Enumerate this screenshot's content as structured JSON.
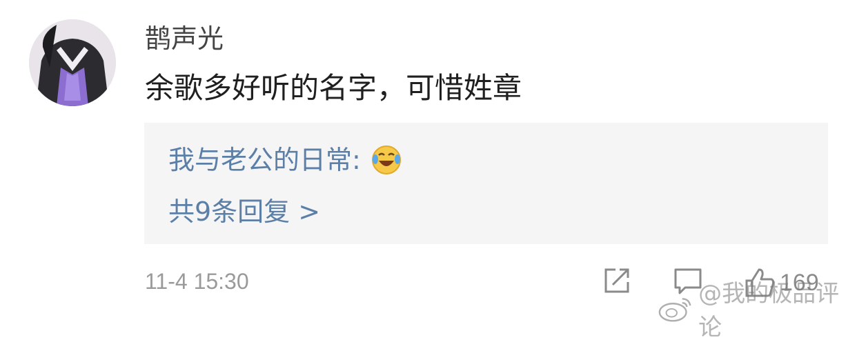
{
  "comment": {
    "username": "鹊声光",
    "text": "余歌多好听的名字，可惜姓章",
    "timestamp": "11-4 15:30",
    "like_count": "169"
  },
  "reply_preview": {
    "author_label": "我与老公的日常:",
    "emoji": "laughing-crying-emoji",
    "count_link": "共9条回复 >"
  },
  "icons": {
    "share": "share-icon",
    "comment": "comment-icon",
    "like": "thumbs-up-icon"
  },
  "watermark": {
    "text": "@我的极品评论"
  },
  "colors": {
    "link": "#5b7fa7",
    "reply_bg": "#f5f5f5",
    "meta": "#9a9a9a"
  }
}
